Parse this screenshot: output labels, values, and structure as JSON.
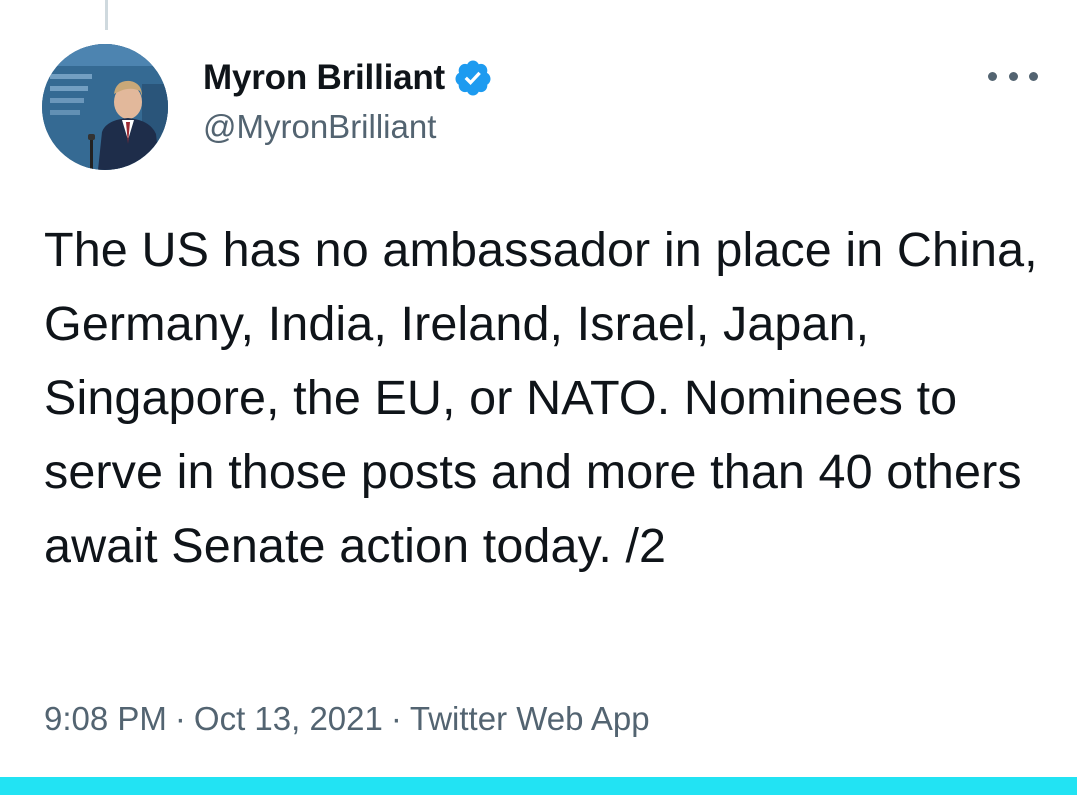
{
  "tweet": {
    "author": {
      "display_name": "Myron Brilliant",
      "handle": "@MyronBrilliant",
      "verified": true,
      "avatar_icon": "profile-photo-speaker-at-podium"
    },
    "text": "The US has no ambassador in place in China, Germany, India, Ireland, Israel, Japan, Singapore, the EU, or NATO. Nominees to serve in those posts and more than 40 others await Senate action today. /2",
    "time": "9:08 PM",
    "date": "Oct 13, 2021",
    "source": "Twitter Web App",
    "separator": "·",
    "more_icon": "more-horizontal-icon"
  },
  "colors": {
    "text_primary": "#0f1419",
    "text_secondary": "#536471",
    "verified_blue": "#1d9bf0",
    "accent_bar": "#22e3f3",
    "thread_line": "#cfd9de"
  }
}
